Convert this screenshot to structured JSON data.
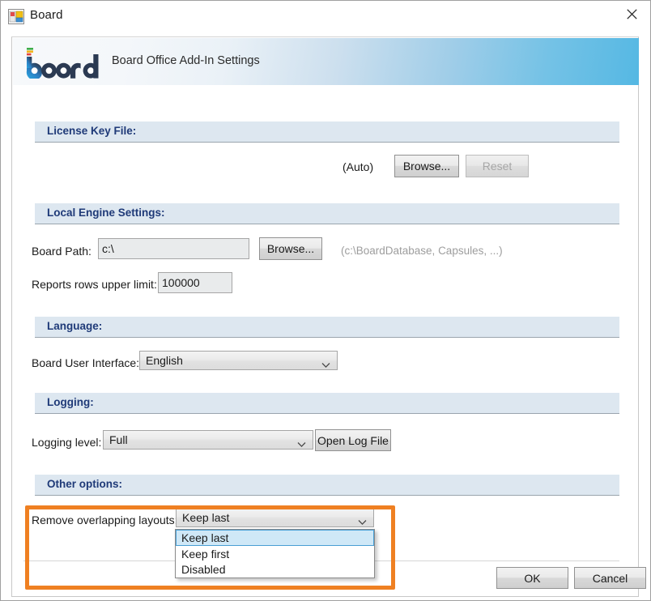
{
  "window": {
    "title": "Board",
    "icon": "windows-forms-icon",
    "close_label": "✕"
  },
  "branding": {
    "logo_text": "board",
    "title": "Board Office Add-In Settings"
  },
  "sections": {
    "license": {
      "header": "License Key File:",
      "auto_text": "(Auto)",
      "browse_label": "Browse...",
      "reset_label": "Reset"
    },
    "local_engine": {
      "header": "Local Engine Settings:",
      "board_path_label": "Board Path:",
      "board_path_value": "c:\\",
      "browse_label": "Browse...",
      "board_path_hint": "(c:\\BoardDatabase, Capsules, ...)",
      "rows_label": "Reports rows upper limit:",
      "rows_value": "100000"
    },
    "language": {
      "header": "Language:",
      "ui_label": "Board User Interface:",
      "ui_value": "English"
    },
    "logging": {
      "header": "Logging:",
      "level_label": "Logging level:",
      "level_value": "Full",
      "open_log_label": "Open Log File"
    },
    "other": {
      "header": "Other options:",
      "overlap_label": "Remove overlapping layouts:",
      "overlap_value": "Keep last",
      "overlap_options": [
        "Keep last",
        "Keep first",
        "Disabled"
      ],
      "overlap_selected_index": 0
    }
  },
  "footer": {
    "ok_label": "OK",
    "cancel_label": "Cancel"
  },
  "colors": {
    "accent_blue": "#1f3a78",
    "section_bar": "#dde7f0",
    "highlight_orange": "#ef8022",
    "selection_blue": "#cfe8f7",
    "brand_gradient_end": "#55b8e3"
  }
}
